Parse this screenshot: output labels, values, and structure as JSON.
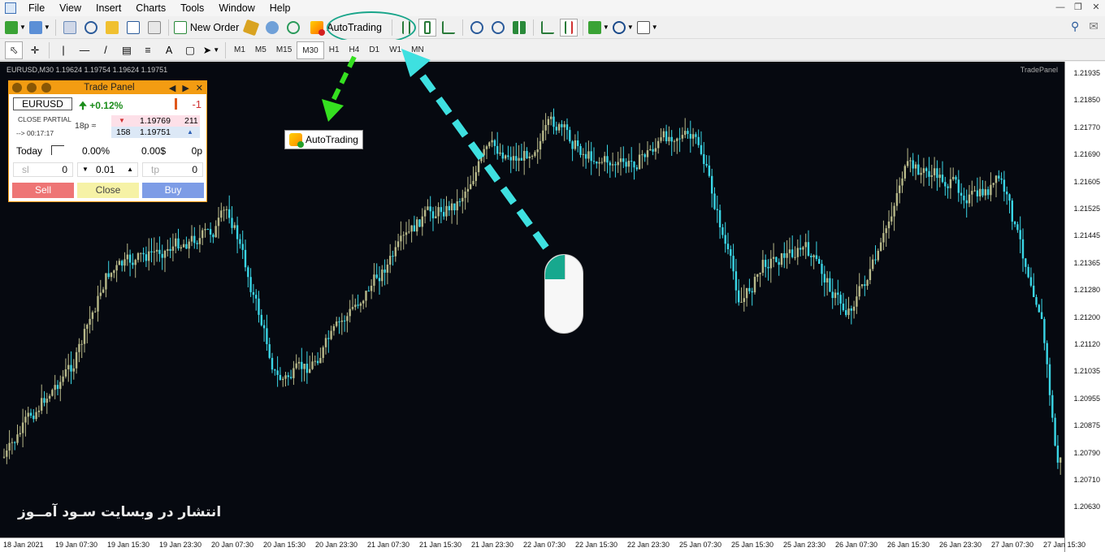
{
  "menu": [
    "File",
    "View",
    "Insert",
    "Charts",
    "Tools",
    "Window",
    "Help"
  ],
  "toolbar": {
    "new_order_label": "New Order",
    "autotrading_label": "AutoTrading"
  },
  "timeframes": [
    "M1",
    "M5",
    "M15",
    "M30",
    "H1",
    "H4",
    "D1",
    "W1",
    "MN"
  ],
  "active_timeframe": "M30",
  "chart": {
    "header": "EURUSD,M30  1.19624 1.19754 1.19624 1.19751",
    "tradepanel_label": "TradePanel",
    "price_labels": [
      "1.21935",
      "1.21850",
      "1.21770",
      "1.21690",
      "1.21605",
      "1.21525",
      "1.21445",
      "1.21365",
      "1.21280",
      "1.21200",
      "1.21120",
      "1.21035",
      "1.20955",
      "1.20875",
      "1.20790",
      "1.20710",
      "1.20630"
    ],
    "time_labels": [
      "18 Jan 2021",
      "19 Jan 07:30",
      "19 Jan 15:30",
      "19 Jan 23:30",
      "20 Jan 07:30",
      "20 Jan 15:30",
      "20 Jan 23:30",
      "21 Jan 07:30",
      "21 Jan 15:30",
      "21 Jan 23:30",
      "22 Jan 07:30",
      "22 Jan 15:30",
      "22 Jan 23:30",
      "25 Jan 07:30",
      "25 Jan 15:30",
      "25 Jan 23:30",
      "26 Jan 07:30",
      "26 Jan 15:30",
      "26 Jan 23:30",
      "27 Jan 07:30",
      "27 Jan 15:30"
    ],
    "watermark": "انتشار در وبسایت سـود آمــوز",
    "colors": {
      "background": "#060910",
      "bull": "#b7b889",
      "bear": "#3ad6e6"
    }
  },
  "trade_panel": {
    "title": "Trade Panel",
    "symbol": "EURUSD",
    "change": "+0.12%",
    "position_count": "-1",
    "close_partial": "CLOSE PARTIAL",
    "timer": "--> 00:17:17",
    "spread": "18p",
    "bid_price": "1.19769",
    "bid_volume": "211",
    "ask_volume": "158",
    "ask_price": "1.19751",
    "today_label": "Today",
    "today_pct": "0.00%",
    "today_money": "0.00$",
    "today_pips": "0p",
    "sl_placeholder": "sl",
    "sl_value": "0",
    "lot_value": "0.01",
    "tp_placeholder": "tp",
    "tp_value": "0",
    "sell_label": "Sell",
    "close_label": "Close",
    "buy_label": "Buy"
  },
  "popup": {
    "label": "AutoTrading"
  }
}
